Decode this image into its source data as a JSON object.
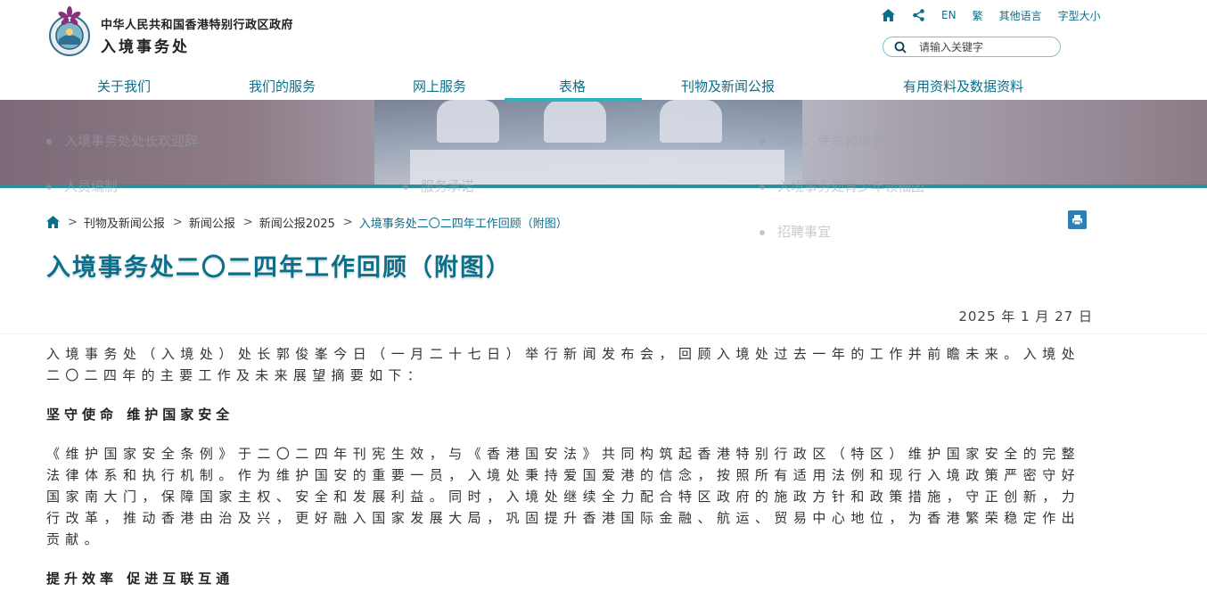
{
  "header": {
    "gov_line1": "中华人民共和国香港特别行政区政府",
    "gov_line2": "入境事务处",
    "top_links": {
      "en": "EN",
      "trad": "繁",
      "other_lang": "其他语言",
      "font_size": "字型大小"
    },
    "search": {
      "placeholder": "请输入关键字",
      "value": ""
    }
  },
  "nav": {
    "items": [
      "关于我们",
      "我们的服务",
      "网上服务",
      "表格",
      "刊物及新闻公报",
      "有用资料及数据资料"
    ],
    "active": "表格"
  },
  "mega_menu_ghost": {
    "col1": [
      "入境事务处处长欢迎辞",
      "人员编制"
    ],
    "col2": [
      "服务承诺"
    ],
    "col3": [
      "理想、使命和信念",
      "入境事务处青少年领袖团",
      "招聘事宜"
    ]
  },
  "breadcrumb": [
    "刊物及新闻公报",
    "新闻公报",
    "新闻公报2025",
    "入境事务处二〇二四年工作回顾（附图）"
  ],
  "page": {
    "title": "入境事务处二〇二四年工作回顾（附图）",
    "date": "2025 年 1 月 27 日"
  },
  "article": {
    "intro": "入境事务处（入境处）处长郭俊峯今日（一月二十七日）举行新闻发布会，回顾入境处过去一年的工作并前瞻未来。入境处二〇二四年的主要工作及未来展望摘要如下：",
    "heading1": "坚守使命 维护国家安全",
    "para1": "《维护国家安全条例》于二〇二四年刊宪生效，与《香港国安法》共同构筑起香港特别行政区（特区）维护国家安全的完整法律体系和执行机制。作为维护国安的重要一员，入境处秉持爱国爱港的信念，按照所有适用法例和现行入境政策严密守好国家南大门，保障国家主权、安全和发展利益。同时，入境处继续全力配合特区政府的施政方针和政策措施，守正创新，力行改革，推动香港由治及兴，更好融入国家发展大局，巩固提升香港国际金融、航运、贸易中心地位，为香港繁荣稳定作出贡献。",
    "heading2": "提升效率 促进互联互通"
  },
  "colors": {
    "accent": "#0b6f8a",
    "nav_active_bar": "#2bb3c0",
    "banner_bottom": "#2b8f9c",
    "print_button": "#2f7fb0"
  }
}
